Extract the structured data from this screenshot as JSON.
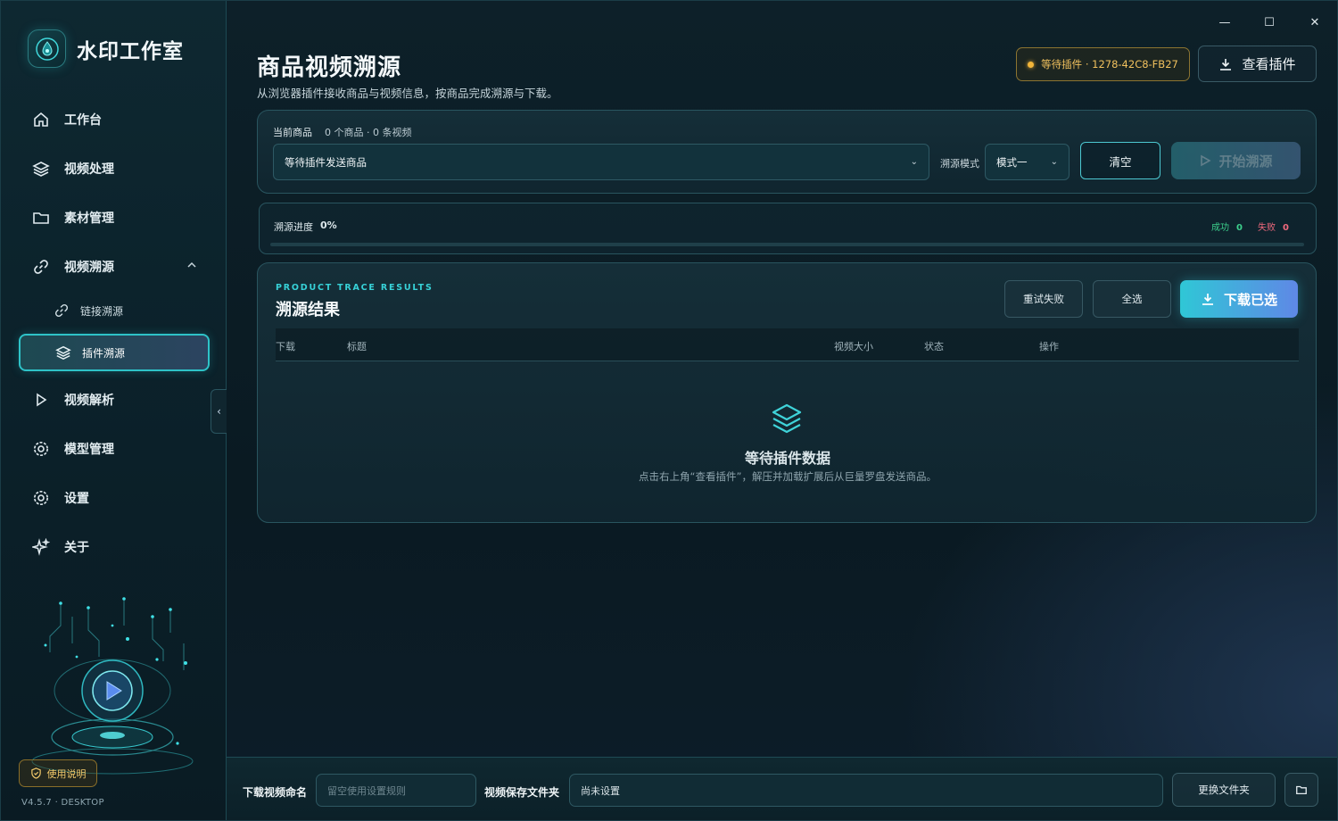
{
  "brand": {
    "title": "水印工作室"
  },
  "window": {
    "minimize": "—",
    "maximize": "☐",
    "close": "✕"
  },
  "sidebar": {
    "items": [
      {
        "label": "工作台",
        "icon": "home-icon"
      },
      {
        "label": "视频处理",
        "icon": "layers-icon"
      },
      {
        "label": "素材管理",
        "icon": "folder-icon"
      },
      {
        "label": "视频溯源",
        "icon": "link-icon",
        "expanded": true
      },
      {
        "label": "视频解析",
        "icon": "play-icon"
      },
      {
        "label": "模型管理",
        "icon": "gear-icon"
      },
      {
        "label": "设置",
        "icon": "gear-icon"
      },
      {
        "label": "关于",
        "icon": "sparkle-icon"
      }
    ],
    "sub_items": [
      {
        "label": "链接溯源",
        "icon": "link-icon"
      },
      {
        "label": "插件溯源",
        "icon": "layers-icon",
        "active": true
      }
    ],
    "help_label": "使用说明",
    "version": "V4.5.7 · DESKTOP"
  },
  "header": {
    "title": "商品视频溯源",
    "subtitle": "从浏览器插件接收商品与视频信息，按商品完成溯源与下载。",
    "status_pill": "等待插件 · 1278-42C8-FB27",
    "view_plugin_label": "查看插件"
  },
  "controls": {
    "current_label": "当前商品",
    "current_count": "0 个商品 · 0 条视频",
    "product_select_value": "等待插件发送商品",
    "mode_label": "溯源模式",
    "mode_value": "模式一",
    "clear_label": "清空",
    "start_label": "开始溯源"
  },
  "progress": {
    "label": "溯源进度",
    "percent_text": "0%",
    "percent_value": 0,
    "success_label": "成功",
    "success_count": "0",
    "fail_label": "失败",
    "fail_count": "0"
  },
  "results": {
    "eyebrow": "PRODUCT TRACE RESULTS",
    "title": "溯源结果",
    "retry_label": "重试失败",
    "select_all_label": "全选",
    "download_label": "下载已选",
    "columns": [
      "下载",
      "标题",
      "视频大小",
      "状态",
      "操作"
    ],
    "empty_title": "等待插件数据",
    "empty_sub": "点击右上角“查看插件”，解压并加载扩展后从巨量罗盘发送商品。"
  },
  "footer": {
    "naming_label": "下载视频命名",
    "naming_placeholder": "留空使用设置规则",
    "folder_label": "视频保存文件夹",
    "folder_value": "尚未设置",
    "change_folder_label": "更换文件夹"
  },
  "colors": {
    "accent": "#2ec3c8",
    "warning": "#f2b53a",
    "success": "#3ccf8c",
    "danger": "#f0697d"
  }
}
